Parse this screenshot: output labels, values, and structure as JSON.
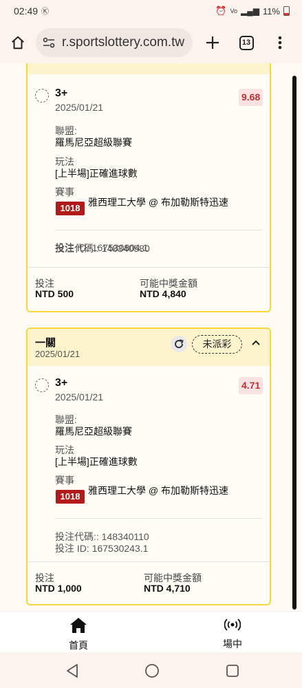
{
  "status_bar": {
    "time": "02:49",
    "battery": "11%"
  },
  "browser": {
    "url": "r.sportslottery.com.tw",
    "tab_count": "13"
  },
  "bets": [
    {
      "title": "",
      "date": "",
      "selection": "3+",
      "selection_date": "2025/01/21",
      "odds": "9.68",
      "league_label": "聯盟:",
      "league": "羅馬尼亞超級聯賽",
      "market_label": "玩法",
      "market": "[上半場]正確進球數",
      "event_label": "賽事",
      "event_number": "1018",
      "event_name": "雅西理工大學 @ 布加勒斯特迅速",
      "bet_code": "投注代碼:: 148340580",
      "bet_id": "投注 ID: 167530804.1",
      "stake_label": "投注",
      "stake": "NTD 500",
      "payout_label": "可能中獎金額",
      "payout": "NTD 4,840"
    },
    {
      "title": "一關",
      "date": "2025/01/21",
      "status": "未派彩",
      "selection": "3+",
      "selection_date": "2025/01/21",
      "odds": "4.71",
      "league_label": "聯盟:",
      "league": "羅馬尼亞超級聯賽",
      "market_label": "玩法",
      "market": "[上半場]正確進球數",
      "event_label": "賽事",
      "event_number": "1018",
      "event_name": "雅西理工大學 @ 布加勒斯特迅速",
      "bet_code": "投注代碼:: 148340110",
      "bet_id": "投注 ID: 167530243.1",
      "stake_label": "投注",
      "stake": "NTD 1,000",
      "payout_label": "可能中獎金額",
      "payout": "NTD 4,710"
    }
  ],
  "bottom_nav": {
    "home_label": "首頁",
    "live_label": "場中"
  },
  "icons": {
    "home": "home-icon",
    "site_settings": "tune-icon",
    "new_tab": "plus-icon",
    "tabs": "tab-switcher-icon",
    "menu": "more-vert-icon",
    "refresh": "refresh-icon",
    "collapse": "chevron-up-icon",
    "live": "broadcast-icon",
    "back": "back-triangle-icon",
    "home_sys": "home-circle-icon",
    "recents": "recents-square-icon"
  },
  "colors": {
    "card_border": "#f5d63d",
    "card_header": "#fdf3cc",
    "odds_text": "#c03030",
    "event_badge": "#b31b1b"
  }
}
